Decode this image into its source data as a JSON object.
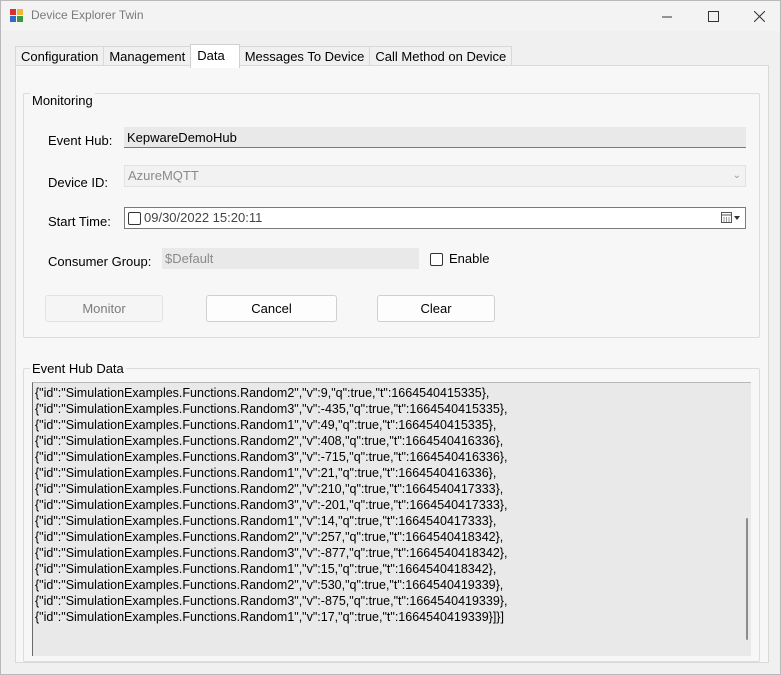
{
  "window": {
    "title": "Device Explorer Twin"
  },
  "tabs": [
    {
      "label": "Configuration"
    },
    {
      "label": "Management"
    },
    {
      "label": "Data"
    },
    {
      "label": "Messages To Device"
    },
    {
      "label": "Call Method on Device"
    }
  ],
  "monitoring": {
    "group_label": "Monitoring",
    "event_hub_label": "Event Hub:",
    "event_hub_value": "KepwareDemoHub",
    "device_id_label": "Device ID:",
    "device_id_value": "AzureMQTT",
    "start_time_label": "Start Time:",
    "start_time_value": "09/30/2022 15:20:11",
    "consumer_group_label": "Consumer Group:",
    "consumer_group_value": "$Default",
    "enable_label": "Enable",
    "monitor_button": "Monitor",
    "cancel_button": "Cancel",
    "clear_button": "Clear"
  },
  "event_hub_data": {
    "group_label": "Event Hub Data",
    "lines": [
      "{\"id\":\"SimulationExamples.Functions.Random2\",\"v\":9,\"q\":true,\"t\":1664540415335},",
      "{\"id\":\"SimulationExamples.Functions.Random3\",\"v\":-435,\"q\":true,\"t\":1664540415335},",
      "{\"id\":\"SimulationExamples.Functions.Random1\",\"v\":49,\"q\":true,\"t\":1664540415335},",
      "{\"id\":\"SimulationExamples.Functions.Random2\",\"v\":408,\"q\":true,\"t\":1664540416336},",
      "{\"id\":\"SimulationExamples.Functions.Random3\",\"v\":-715,\"q\":true,\"t\":1664540416336},",
      "{\"id\":\"SimulationExamples.Functions.Random1\",\"v\":21,\"q\":true,\"t\":1664540416336},",
      "{\"id\":\"SimulationExamples.Functions.Random2\",\"v\":210,\"q\":true,\"t\":1664540417333},",
      "{\"id\":\"SimulationExamples.Functions.Random3\",\"v\":-201,\"q\":true,\"t\":1664540417333},",
      "{\"id\":\"SimulationExamples.Functions.Random1\",\"v\":14,\"q\":true,\"t\":1664540417333},",
      "{\"id\":\"SimulationExamples.Functions.Random2\",\"v\":257,\"q\":true,\"t\":1664540418342},",
      "{\"id\":\"SimulationExamples.Functions.Random3\",\"v\":-877,\"q\":true,\"t\":1664540418342},",
      "{\"id\":\"SimulationExamples.Functions.Random1\",\"v\":15,\"q\":true,\"t\":1664540418342},",
      "{\"id\":\"SimulationExamples.Functions.Random2\",\"v\":530,\"q\":true,\"t\":1664540419339},",
      "{\"id\":\"SimulationExamples.Functions.Random3\",\"v\":-875,\"q\":true,\"t\":1664540419339},",
      "{\"id\":\"SimulationExamples.Functions.Random1\",\"v\":17,\"q\":true,\"t\":1664540419339}]}]"
    ]
  },
  "icons": {
    "app": "app-icon",
    "minimize": "minimize-icon",
    "maximize": "maximize-icon",
    "close": "close-icon",
    "dropdown": "chevron-down-icon",
    "calendar": "calendar-icon"
  }
}
